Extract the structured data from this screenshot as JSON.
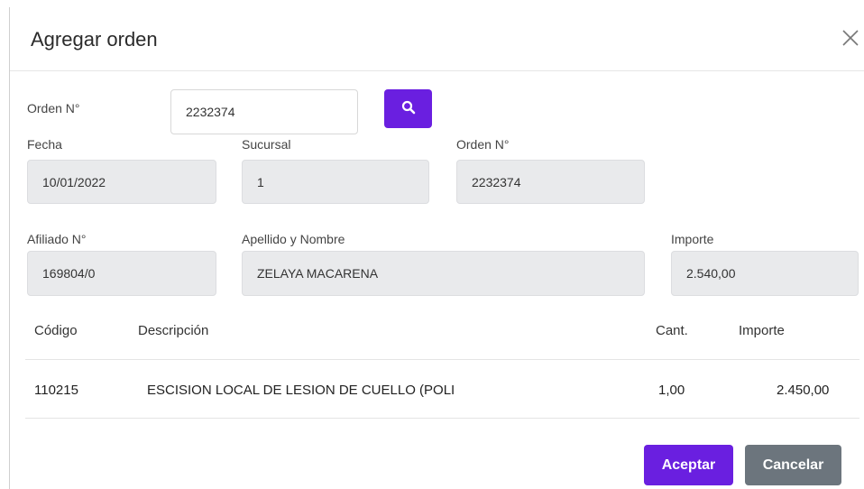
{
  "dialog": {
    "title": "Agregar orden",
    "close_icon": "close-icon"
  },
  "search": {
    "label": "Orden N°",
    "value": "2232374",
    "button_icon": "search-icon"
  },
  "fields": {
    "fecha": {
      "label": "Fecha",
      "value": "10/01/2022"
    },
    "sucursal": {
      "label": "Sucursal",
      "value": "1"
    },
    "orden": {
      "label": "Orden N°",
      "value": "2232374"
    },
    "afiliado": {
      "label": "Afiliado N°",
      "value": "169804/0"
    },
    "nombre": {
      "label": "Apellido y Nombre",
      "value": "ZELAYA MACARENA"
    },
    "importe": {
      "label": "Importe",
      "value": "2.540,00"
    }
  },
  "table": {
    "headers": [
      "Código",
      "Descripción",
      "Cant.",
      "Importe"
    ],
    "rows": [
      [
        "110215",
        "ESCISION LOCAL DE LESION DE CUELLO (POLI",
        "1,00",
        "2.450,00"
      ]
    ]
  },
  "actions": {
    "accept": "Aceptar",
    "cancel": "Cancelar"
  },
  "colors": {
    "primary": "#6a1fe0",
    "secondary": "#6c757d",
    "readonly_bg": "#e9eaec"
  }
}
